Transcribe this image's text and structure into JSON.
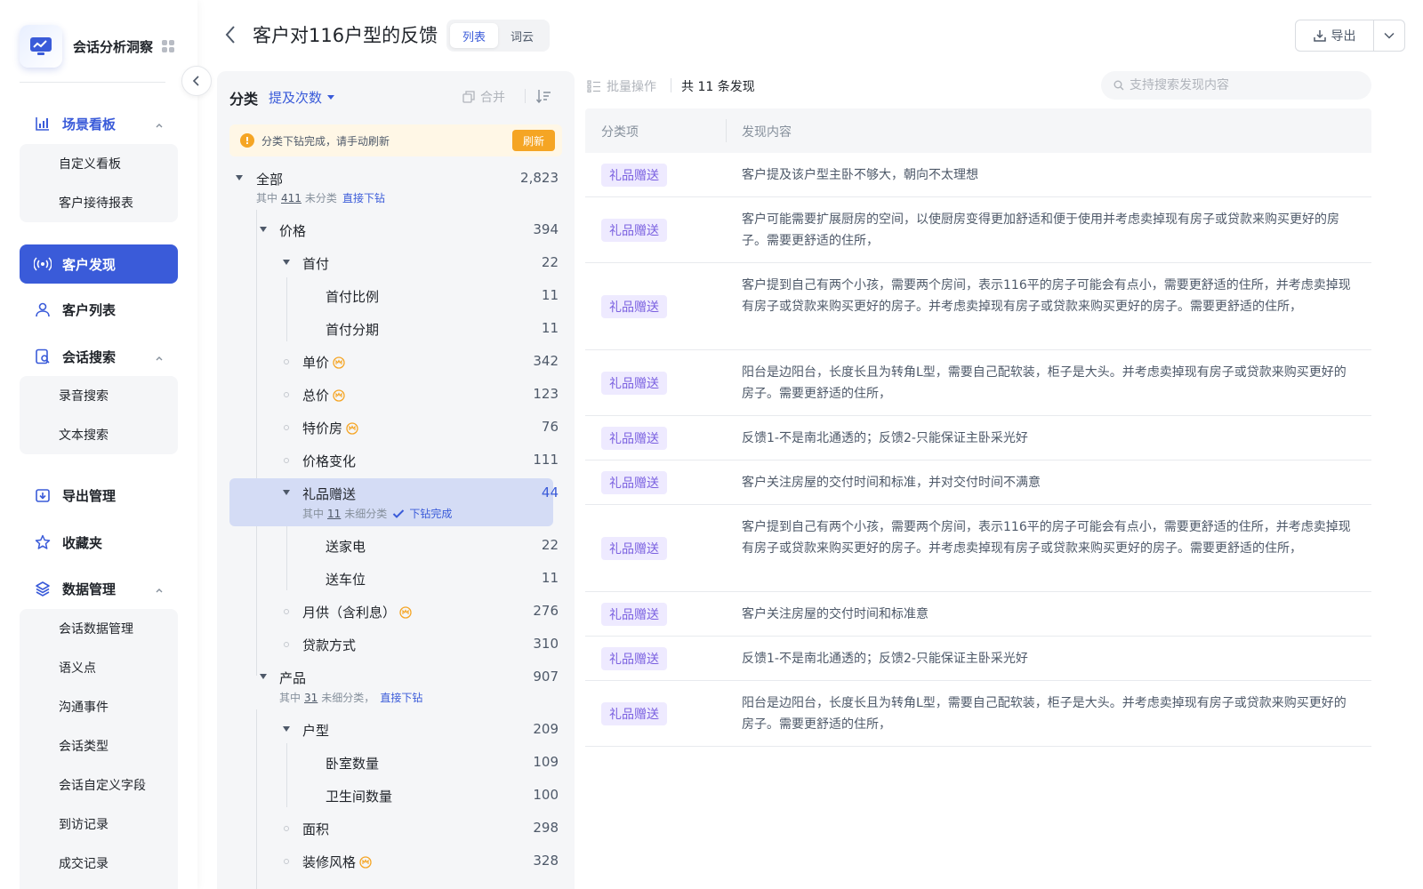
{
  "brand": {
    "title": "会话分析洞察"
  },
  "sidebar": {
    "groups": [
      {
        "label": "场景看板",
        "items": [
          "自定义看板",
          "客户接待报表"
        ]
      },
      {
        "label": "客户发现"
      },
      {
        "label": "客户列表"
      },
      {
        "label": "会话搜索",
        "items": [
          "录音搜索",
          "文本搜索"
        ]
      },
      {
        "label": "导出管理"
      },
      {
        "label": "收藏夹"
      },
      {
        "label": "数据管理",
        "items": [
          "会话数据管理",
          "语义点",
          "沟通事件",
          "会话类型",
          "会话自定义字段",
          "到访记录",
          "成交记录"
        ]
      }
    ]
  },
  "header": {
    "title": "客户对116户型的反馈",
    "tabs": [
      "列表",
      "词云"
    ],
    "export_label": "导出"
  },
  "categories": {
    "title": "分类",
    "sort_label": "提及次数",
    "merge_label": "合并",
    "notice_text": "分类下钻完成，请手动刷新",
    "notice_button": "刷新",
    "all": {
      "label": "全部",
      "count": "2,823",
      "sub_prefix": "其中",
      "sub_num": "411",
      "sub_suffix": "未分类",
      "sub_link": "直接下钻"
    },
    "price": {
      "label": "价格",
      "count": "394"
    },
    "down_payment": {
      "label": "首付",
      "count": "22"
    },
    "down_ratio": {
      "label": "首付比例",
      "count": "11"
    },
    "down_install": {
      "label": "首付分期",
      "count": "11"
    },
    "unit_price": {
      "label": "单价",
      "count": "342"
    },
    "total_price": {
      "label": "总价",
      "count": "123"
    },
    "special": {
      "label": "特价房",
      "count": "76"
    },
    "price_change": {
      "label": "价格变化",
      "count": "111"
    },
    "gift": {
      "label": "礼品赠送",
      "count": "44",
      "sub_prefix": "其中",
      "sub_num": "11",
      "sub_suffix": "未细分类",
      "sub_done": "下钻完成"
    },
    "appliance": {
      "label": "送家电",
      "count": "22"
    },
    "parking": {
      "label": "送车位",
      "count": "11"
    },
    "monthly": {
      "label": "月供（含利息）",
      "count": "276"
    },
    "loan": {
      "label": "贷款方式",
      "count": "310"
    },
    "product": {
      "label": "产品",
      "count": "907",
      "sub_prefix": "其中",
      "sub_num": "31",
      "sub_suffix": "未细分类，",
      "sub_link": "直接下钻"
    },
    "layout": {
      "label": "户型",
      "count": "209"
    },
    "bedrooms": {
      "label": "卧室数量",
      "count": "109"
    },
    "bathrooms": {
      "label": "卫生间数量",
      "count": "100"
    },
    "area": {
      "label": "面积",
      "count": "298"
    },
    "decor": {
      "label": "装修风格",
      "count": "328"
    }
  },
  "findings": {
    "batch_label": "批量操作",
    "total_label": "共 11 条发现",
    "search_placeholder": "支持搜索发现内容",
    "columns": [
      "分类项",
      "发现内容"
    ],
    "rows": [
      {
        "tag": "礼品赠送",
        "content": "客户提及该户型主卧不够大，朝向不太理想"
      },
      {
        "tag": "礼品赠送",
        "content": "客户可能需要扩展厨房的空间，以使厨房变得更加舒适和便于使用并考虑卖掉现有房子或贷款来购买更好的房子。需要更舒适的住所，"
      },
      {
        "tag": "礼品赠送",
        "content": "客户提到自己有两个小孩，需要两个房间，表示116平的房子可能会有点小，需要更舒适的住所，并考虑卖掉现有房子或贷款来购买更好的房子。并考虑卖掉现有房子或贷款来购买更好的房子。需要更舒适的住所，"
      },
      {
        "tag": "礼品赠送",
        "content": "阳台是边阳台，长度长且为转角L型，需要自己配软装，柜子是大头。并考虑卖掉现有房子或贷款来购买更好的房子。需要更舒适的住所，"
      },
      {
        "tag": "礼品赠送",
        "content": "反馈1-不是南北通透的；反馈2-只能保证主卧采光好"
      },
      {
        "tag": "礼品赠送",
        "content": "客户关注房屋的交付时间和标准，并对交付时间不满意"
      },
      {
        "tag": "礼品赠送",
        "content": "客户提到自己有两个小孩，需要两个房间，表示116平的房子可能会有点小，需要更舒适的住所，并考虑卖掉现有房子或贷款来购买更好的房子。并考虑卖掉现有房子或贷款来购买更好的房子。需要更舒适的住所，"
      },
      {
        "tag": "礼品赠送",
        "content": "客户关注房屋的交付时间和标准意"
      },
      {
        "tag": "礼品赠送",
        "content": "反馈1-不是南北通透的；反馈2-只能保证主卧采光好"
      },
      {
        "tag": "礼品赠送",
        "content": "阳台是边阳台，长度长且为转角L型，需要自己配软装，柜子是大头。并考虑卖掉现有房子或贷款来购买更好的房子。需要更舒适的住所，"
      }
    ]
  },
  "colors": {
    "accent": "#3a5bd9",
    "tag_bg": "#eeeaff",
    "tag_text": "#7b61e0",
    "warning": "#f5a524"
  }
}
